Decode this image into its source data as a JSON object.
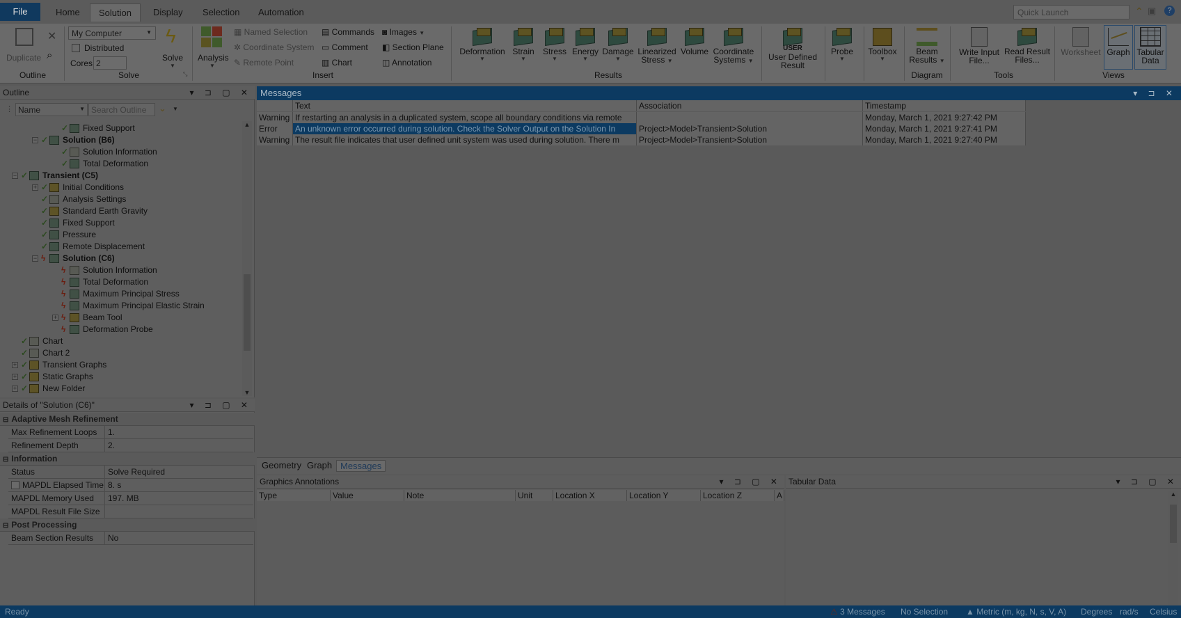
{
  "tabs": {
    "file": "File",
    "home": "Home",
    "solution": "Solution",
    "display": "Display",
    "selection": "Selection",
    "automation": "Automation"
  },
  "quick_launch_placeholder": "Quick Launch",
  "ribbon": {
    "outline": {
      "duplicate": "Duplicate",
      "group": "Outline"
    },
    "solve": {
      "machine": "My Computer",
      "distributed": "Distributed",
      "cores_label": "Cores",
      "cores_value": "2",
      "solve": "Solve",
      "group": "Solve"
    },
    "analysis": "Analysis",
    "insert": {
      "named_selection": "Named Selection",
      "coordinate_system": "Coordinate System",
      "remote_point": "Remote Point",
      "commands": "Commands",
      "comment": "Comment",
      "chart": "Chart",
      "images": "Images",
      "section_plane": "Section Plane",
      "annotation": "Annotation",
      "group": "Insert"
    },
    "results": {
      "deformation": "Deformation",
      "strain": "Strain",
      "stress": "Stress",
      "energy": "Energy",
      "damage": "Damage",
      "linearized": "Linearized",
      "linearized2": "Stress",
      "volume": "Volume",
      "coordinate": "Coordinate",
      "coordinate2": "Systems",
      "user_defined": "User Defined",
      "user_defined2": "Result",
      "user_icon": "USER",
      "group": "Results"
    },
    "probe": "Probe",
    "toolbox": "Toolbox",
    "beam": {
      "l1": "Beam",
      "l2": "Results",
      "group": "Diagram"
    },
    "tools": {
      "write_input": "Write Input",
      "write_input2": "File...",
      "read_result": "Read Result",
      "read_result2": "Files...",
      "group": "Tools"
    },
    "views": {
      "worksheet": "Worksheet",
      "graph": "Graph",
      "tabular": "Tabular",
      "tabular2": "Data",
      "group": "Views"
    }
  },
  "outline": {
    "title": "Outline",
    "name_filter": "Name",
    "search_placeholder": "Search Outline",
    "items": [
      {
        "label": "Fixed Support"
      },
      {
        "label": "Solution (B6)"
      },
      {
        "label": "Solution Information"
      },
      {
        "label": "Total Deformation"
      },
      {
        "label": "Transient (C5)"
      },
      {
        "label": "Initial Conditions"
      },
      {
        "label": "Analysis Settings"
      },
      {
        "label": "Standard Earth Gravity"
      },
      {
        "label": "Fixed Support"
      },
      {
        "label": "Pressure"
      },
      {
        "label": "Remote Displacement"
      },
      {
        "label": "Solution (C6)"
      },
      {
        "label": "Solution Information"
      },
      {
        "label": "Total Deformation"
      },
      {
        "label": "Maximum Principal Stress"
      },
      {
        "label": "Maximum Principal Elastic Strain"
      },
      {
        "label": "Beam Tool"
      },
      {
        "label": "Deformation Probe"
      },
      {
        "label": "Chart"
      },
      {
        "label": "Chart 2"
      },
      {
        "label": "Transient Graphs"
      },
      {
        "label": "Static Graphs"
      },
      {
        "label": "New Folder"
      }
    ]
  },
  "details": {
    "title": "Details of \"Solution (C6)\"",
    "sections": [
      {
        "name": "Adaptive Mesh Refinement"
      },
      {
        "name": "Information"
      },
      {
        "name": "Post Processing"
      }
    ],
    "rows": [
      {
        "k": "Max Refinement Loops",
        "v": "1."
      },
      {
        "k": "Refinement Depth",
        "v": "2."
      },
      {
        "k": "Status",
        "v": "Solve Required"
      },
      {
        "k": "MAPDL Elapsed Time",
        "v": "8. s"
      },
      {
        "k": "MAPDL Memory Used",
        "v": "197. MB"
      },
      {
        "k": "MAPDL Result File Size",
        "v": ""
      },
      {
        "k": "Beam Section Results",
        "v": "No"
      }
    ]
  },
  "messages": {
    "title": "Messages",
    "columns": [
      "Text",
      "Association",
      "Timestamp"
    ],
    "rows": [
      {
        "type": "Warning",
        "text": "If restarting an analysis in a duplicated system, scope all boundary conditions via remote",
        "assoc": "",
        "time": "Monday, March 1, 2021 9:27:42 PM"
      },
      {
        "type": "Error",
        "text": "An unknown error occurred during solution.  Check the Solver Output on the Solution In",
        "assoc": "Project>Model>Transient>Solution",
        "time": "Monday, March 1, 2021 9:27:41 PM"
      },
      {
        "type": "Warning",
        "text": "The result file indicates that user defined unit system was used during solution.  There m",
        "assoc": "Project>Model>Transient>Solution",
        "time": "Monday, March 1, 2021 9:27:40 PM"
      }
    ]
  },
  "bottom_tabs": [
    "Geometry",
    "Graph",
    "Messages"
  ],
  "annotations": {
    "title": "Graphics Annotations",
    "columns": [
      "Type",
      "Value",
      "Note",
      "Unit",
      "Location X",
      "Location Y",
      "Location Z",
      "A"
    ]
  },
  "tabular": {
    "title": "Tabular Data"
  },
  "status": {
    "ready": "Ready",
    "messages": "3 Messages",
    "selection": "No Selection",
    "units": "Metric (m, kg, N, s, V, A)",
    "degrees": "Degrees",
    "rads": "rad/s",
    "celsius": "Celsius"
  }
}
